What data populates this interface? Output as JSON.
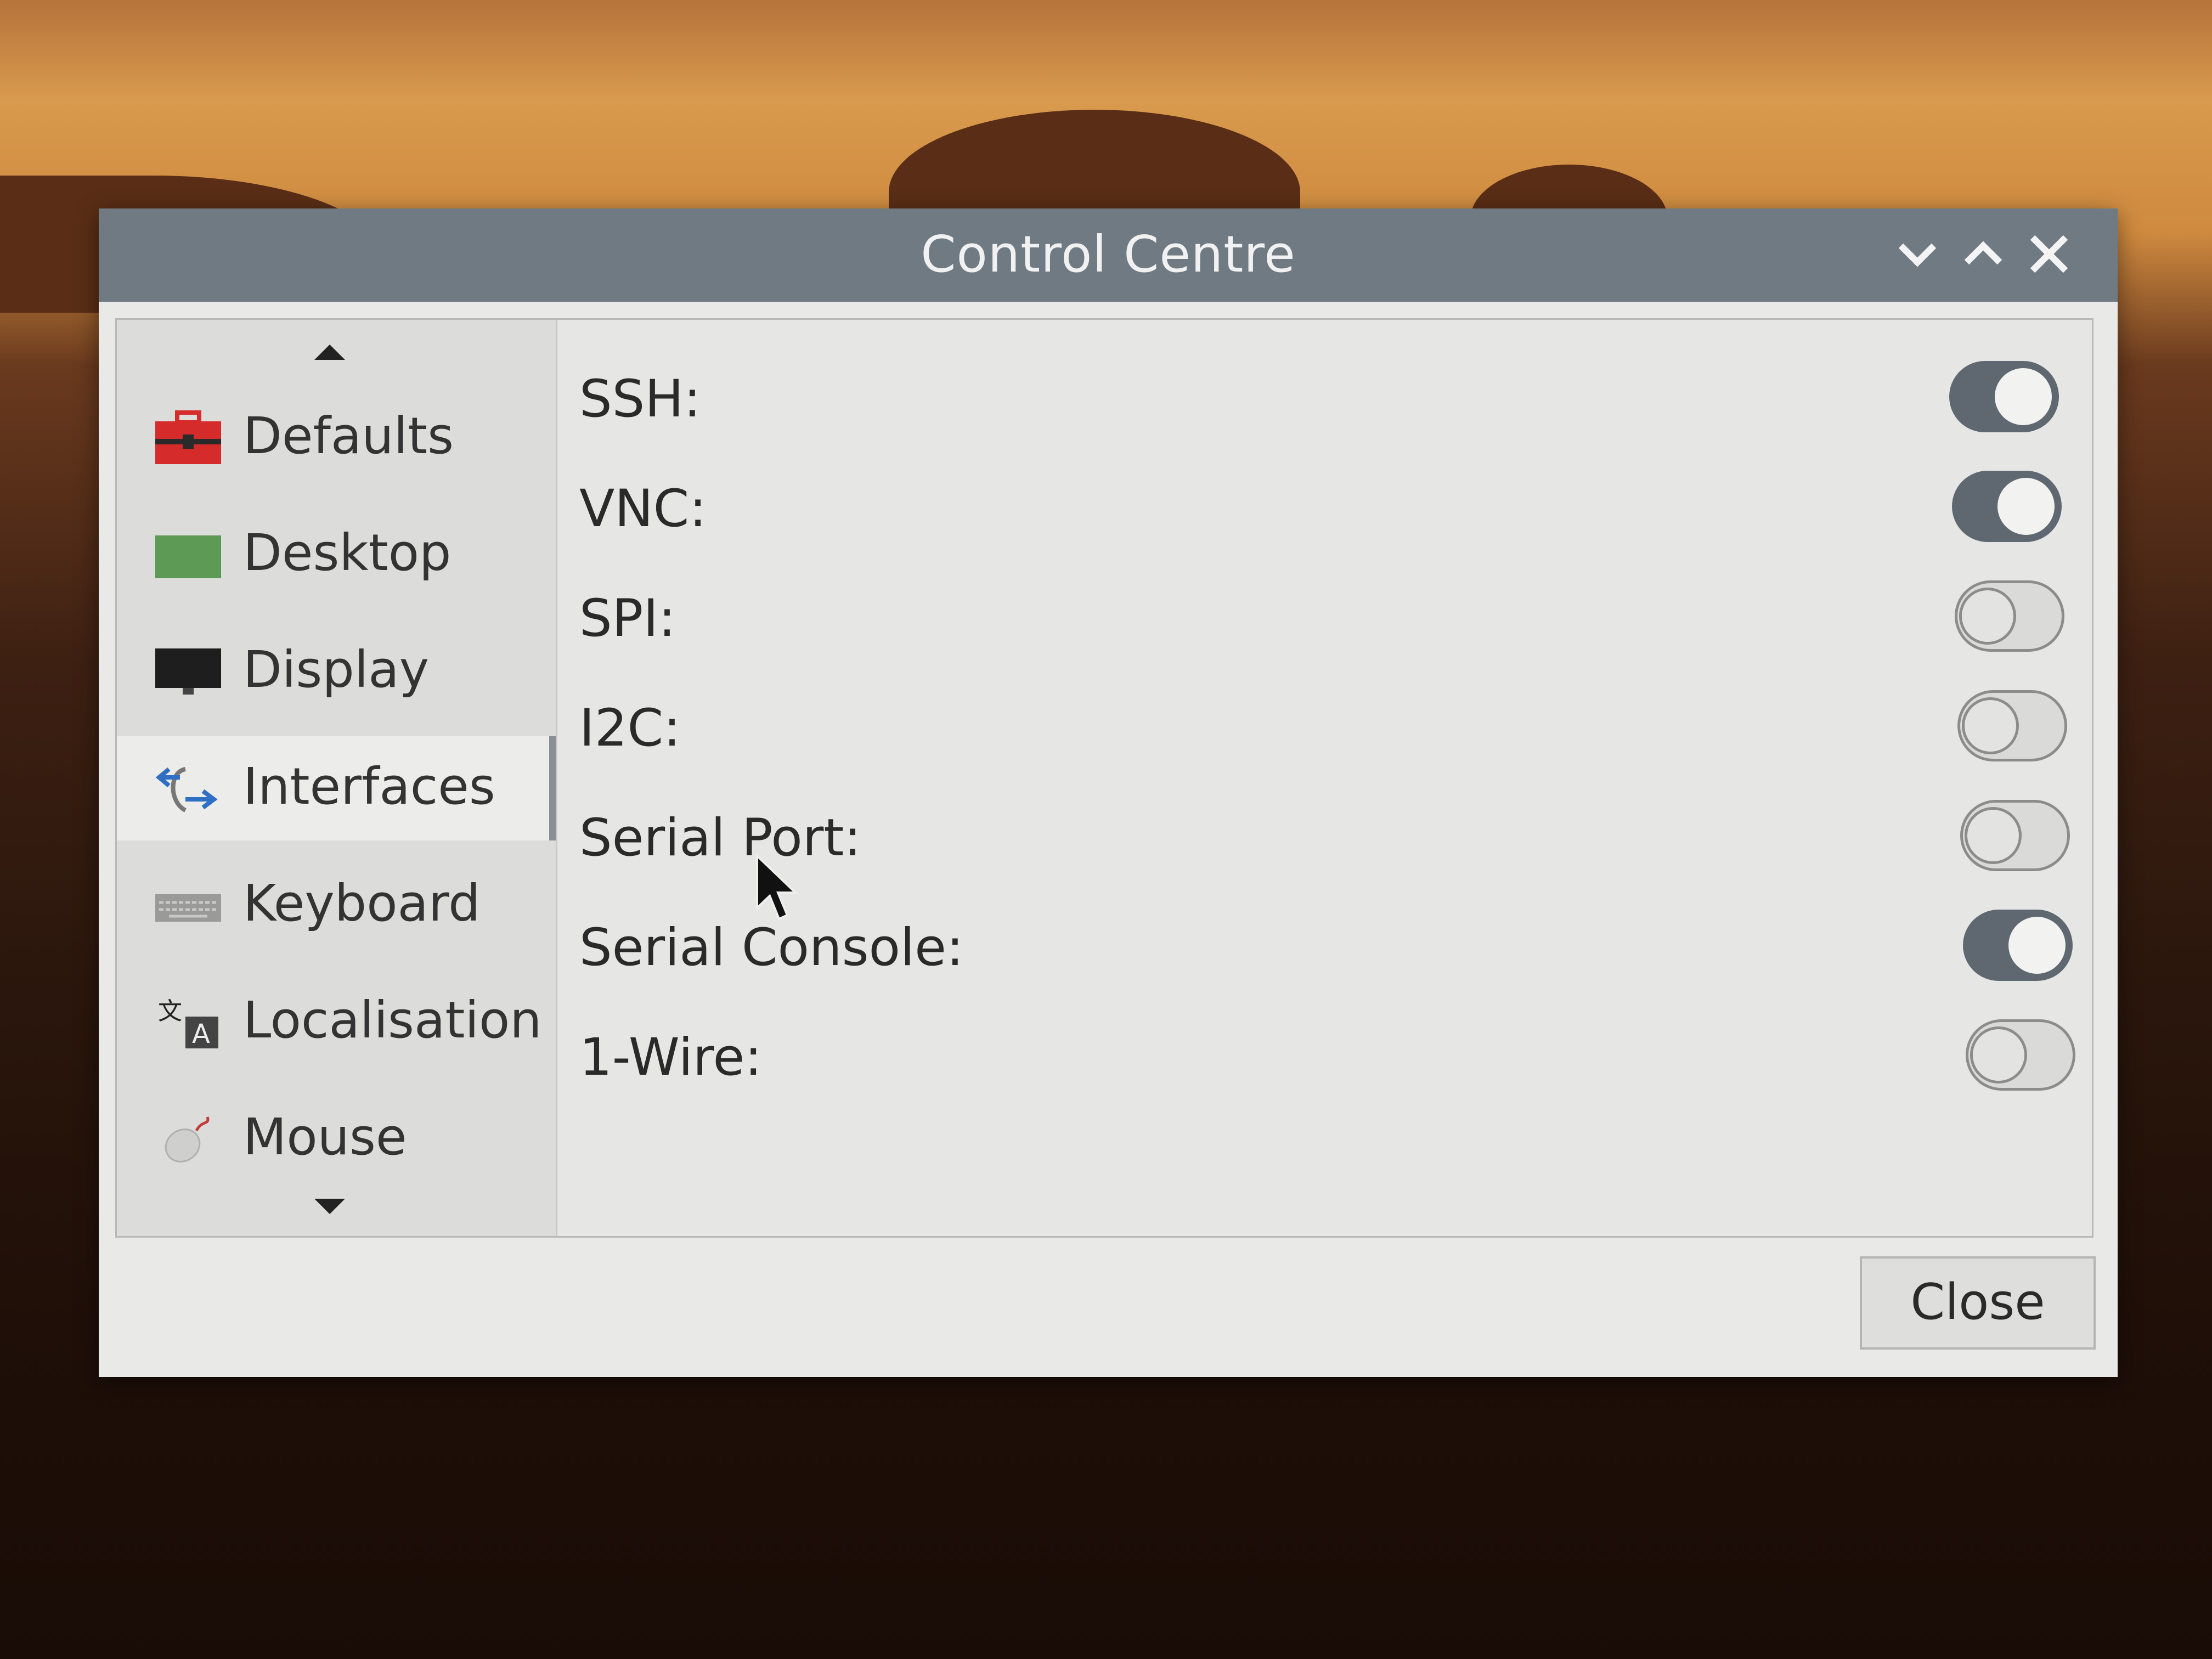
{
  "window": {
    "title": "Control Centre",
    "controls": {
      "minimize": "⌄",
      "maximize": "⌃",
      "close": "✕"
    }
  },
  "sidebar": {
    "items": [
      {
        "label": "Defaults",
        "icon": "toolbox-icon",
        "active": false
      },
      {
        "label": "Desktop",
        "icon": "desktop-icon",
        "active": false
      },
      {
        "label": "Display",
        "icon": "monitor-icon",
        "active": false
      },
      {
        "label": "Interfaces",
        "icon": "interfaces-icon",
        "active": true
      },
      {
        "label": "Keyboard",
        "icon": "keyboard-icon",
        "active": false
      },
      {
        "label": "Localisation",
        "icon": "localisation-icon",
        "active": false
      },
      {
        "label": "Mouse",
        "icon": "mouse-icon",
        "active": false
      }
    ]
  },
  "interfaces": {
    "rows": [
      {
        "label": "SSH:",
        "enabled": true
      },
      {
        "label": "VNC:",
        "enabled": true
      },
      {
        "label": "SPI:",
        "enabled": false
      },
      {
        "label": "I2C:",
        "enabled": false
      },
      {
        "label": "Serial Port:",
        "enabled": false
      },
      {
        "label": "Serial Console:",
        "enabled": true
      },
      {
        "label": "1-Wire:",
        "enabled": false
      }
    ]
  },
  "footer": {
    "close_label": "Close"
  },
  "colors": {
    "titlebar": "#6f7a83",
    "toggle_on": "#5f6870",
    "toggle_off_border": "#8c8c8a"
  }
}
